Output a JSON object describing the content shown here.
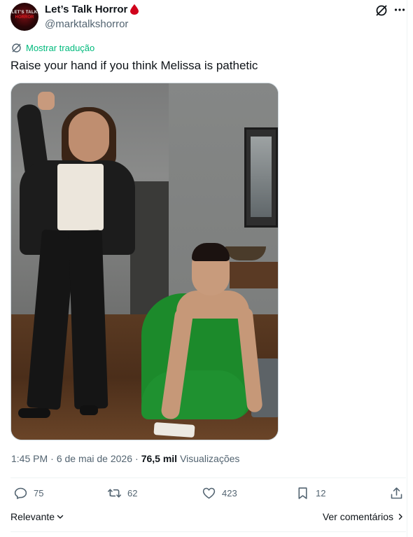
{
  "author": {
    "display_name": "Let’s Talk Horror",
    "handle": "@marktalkshorror",
    "avatar_text_top": "LET'S TALK",
    "avatar_text_bottom": "HORROR",
    "badge_icon": "blood-drop-icon",
    "badge_color": "#e0245e"
  },
  "translate": {
    "label": "Mostrar tradução",
    "icon": "translate-icon",
    "color": "#00ba7c"
  },
  "tweet": {
    "text": "Raise your hand if you think Melissa is pathetic"
  },
  "meta": {
    "time": "1:45 PM",
    "date": "6 de mai de 2026",
    "views_count": "76,5 mil",
    "views_label": "Visualizações"
  },
  "actions": {
    "replies": "75",
    "reposts": "62",
    "likes": "423",
    "bookmarks": "12"
  },
  "footer": {
    "sort_label": "Relevante",
    "see_comments_label": "Ver comentários"
  },
  "colors": {
    "text_primary": "#0f1419",
    "text_secondary": "#536471",
    "divider": "#eff3f4"
  }
}
